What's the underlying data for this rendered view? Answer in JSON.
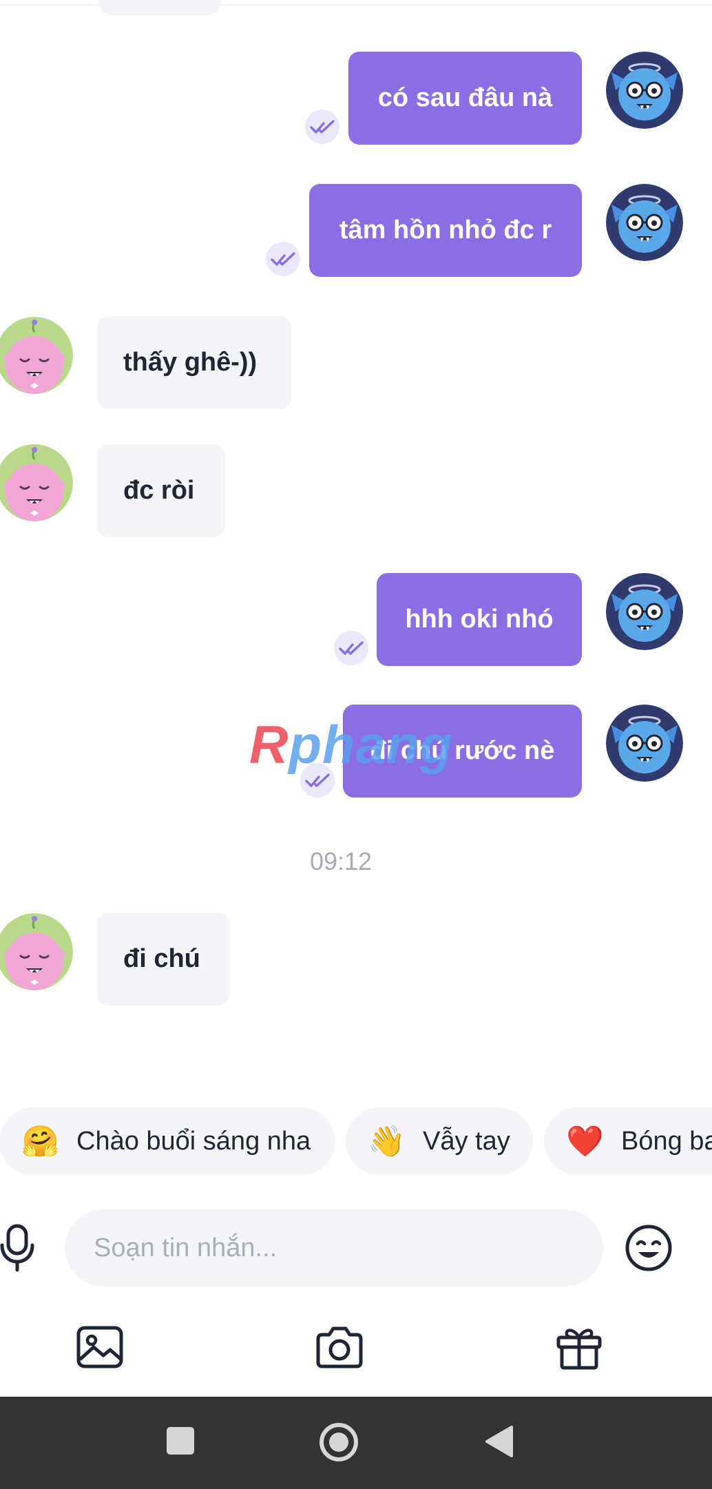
{
  "conversation": {
    "messages": [
      {
        "text": "có sau đâu nà",
        "direction": "out",
        "status": "seen"
      },
      {
        "text": "tâm hồn nhỏ đc r",
        "direction": "out",
        "status": "seen"
      },
      {
        "text": "thấy ghê-))",
        "direction": "in"
      },
      {
        "text": "đc ròi",
        "direction": "in"
      },
      {
        "text": "hhh oki nhó",
        "direction": "out",
        "status": "seen"
      },
      {
        "text": "đi chú rước nè",
        "direction": "out",
        "status": "seen"
      },
      {
        "text": "đi chú",
        "direction": "in"
      }
    ],
    "timestamp": "09:12"
  },
  "watermark": {
    "brand": "Rphang"
  },
  "quick_replies": [
    {
      "emoji": "🤗",
      "label": "Chào buổi sáng nha"
    },
    {
      "emoji": "👋",
      "label": "Vẫy tay"
    },
    {
      "emoji": "❤️",
      "label": "Bóng bay"
    }
  ],
  "composer": {
    "placeholder": "Soạn tin nhắn...",
    "icons": [
      "microphone-icon",
      "emoji-icon",
      "image-icon",
      "camera-icon",
      "gift-icon"
    ]
  },
  "nav_bar": {
    "buttons": [
      "recents-icon",
      "home-icon",
      "back-icon"
    ]
  },
  "colors": {
    "outgoing_bubble": "#8b6de6",
    "incoming_bubble": "#f4f5f8",
    "text_dark": "#1f2535",
    "timestamp": "#a7abb5",
    "seen_badge": "#ece8fb",
    "nav_bar": "#333333"
  }
}
